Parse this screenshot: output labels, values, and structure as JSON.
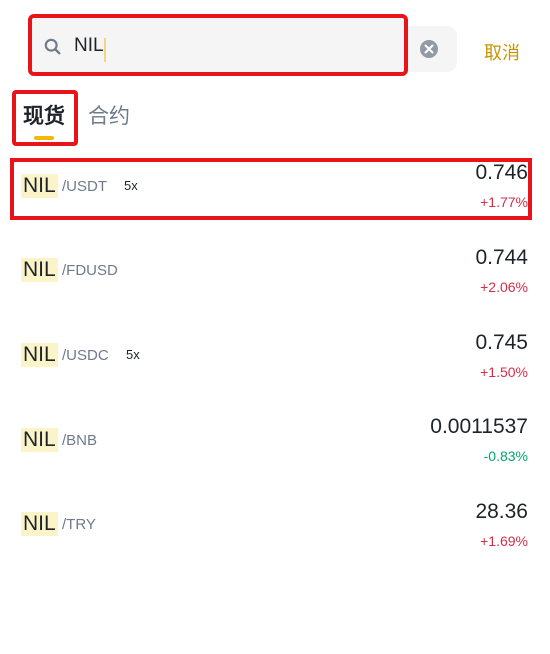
{
  "search": {
    "value": "NIL",
    "cancel_label": "取消"
  },
  "tabs": [
    {
      "label": "现货",
      "active": true
    },
    {
      "label": "合约",
      "active": false
    }
  ],
  "pairs": [
    {
      "base": "NIL",
      "quote": "/USDT",
      "leverage": "5x",
      "price": "0.746",
      "change": "+1.77%",
      "direction": "up"
    },
    {
      "base": "NIL",
      "quote": "/FDUSD",
      "leverage": "",
      "price": "0.744",
      "change": "+2.06%",
      "direction": "up"
    },
    {
      "base": "NIL",
      "quote": "/USDC",
      "leverage": "5x",
      "price": "0.745",
      "change": "+1.50%",
      "direction": "up"
    },
    {
      "base": "NIL",
      "quote": "/BNB",
      "leverage": "",
      "price": "0.0011537",
      "change": "-0.83%",
      "direction": "down"
    },
    {
      "base": "NIL",
      "quote": "/TRY",
      "leverage": "",
      "price": "28.36",
      "change": "+1.69%",
      "direction": "up"
    }
  ],
  "colors": {
    "accent": "#f0b90b",
    "cancel": "#c99400",
    "up": "#cf304a",
    "down": "#03a66d",
    "highlight_box": "#e8141a"
  }
}
